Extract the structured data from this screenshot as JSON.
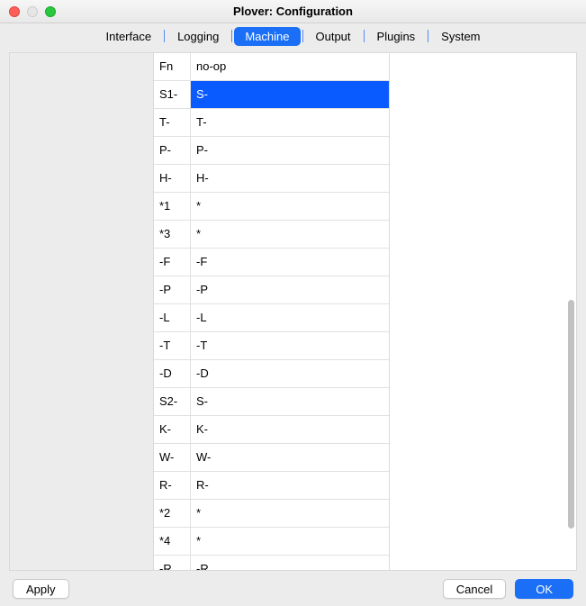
{
  "window": {
    "title": "Plover: Configuration"
  },
  "tabs": {
    "interface": "Interface",
    "logging": "Logging",
    "machine": "Machine",
    "output": "Output",
    "plugins": "Plugins",
    "system": "System"
  },
  "mapping": {
    "selected_index": 1,
    "rows": [
      {
        "key": "Fn",
        "val": "no-op"
      },
      {
        "key": "S1-",
        "val": "S-"
      },
      {
        "key": "T-",
        "val": "T-"
      },
      {
        "key": "P-",
        "val": "P-"
      },
      {
        "key": "H-",
        "val": "H-"
      },
      {
        "key": "*1",
        "val": "*"
      },
      {
        "key": "*3",
        "val": "*"
      },
      {
        "key": "-F",
        "val": "-F"
      },
      {
        "key": "-P",
        "val": "-P"
      },
      {
        "key": "-L",
        "val": "-L"
      },
      {
        "key": "-T",
        "val": "-T"
      },
      {
        "key": "-D",
        "val": "-D"
      },
      {
        "key": "S2-",
        "val": "S-"
      },
      {
        "key": "K-",
        "val": "K-"
      },
      {
        "key": "W-",
        "val": "W-"
      },
      {
        "key": "R-",
        "val": "R-"
      },
      {
        "key": "*2",
        "val": "*"
      },
      {
        "key": "*4",
        "val": "*"
      },
      {
        "key": "-R",
        "val": "-R"
      }
    ]
  },
  "buttons": {
    "apply": "Apply",
    "cancel": "Cancel",
    "ok": "OK"
  }
}
